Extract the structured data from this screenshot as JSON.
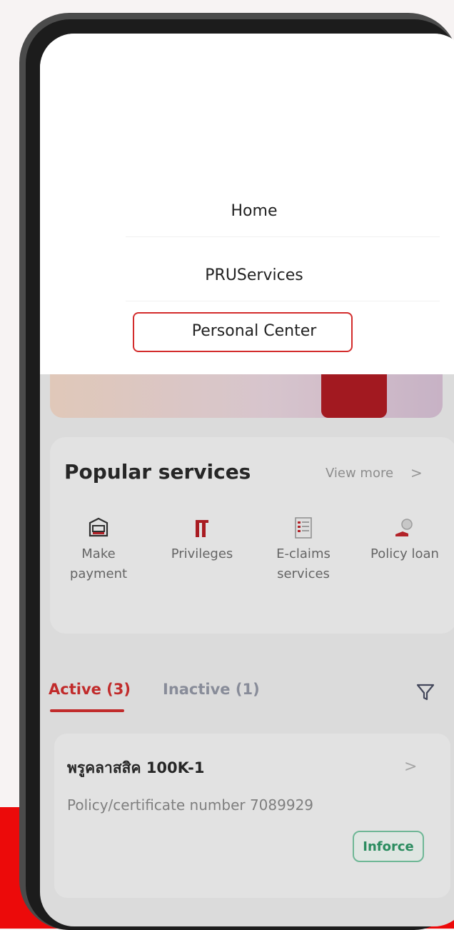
{
  "menu": {
    "items": [
      {
        "label": "Home"
      },
      {
        "label": "PRUServices"
      },
      {
        "label": "Personal Center"
      }
    ],
    "highlighted_index": 2
  },
  "popular_services": {
    "title": "Popular services",
    "view_more": "View more",
    "items": [
      {
        "label_line1": "Make",
        "label_line2": "payment",
        "icon": "card-payment-icon"
      },
      {
        "label_line1": "Privileges",
        "label_line2": "",
        "icon": "privileges-icon"
      },
      {
        "label_line1": "E-claims",
        "label_line2": "services",
        "icon": "document-claims-icon"
      },
      {
        "label_line1": "Policy loan",
        "label_line2": "",
        "icon": "policy-loan-icon"
      }
    ]
  },
  "policy_tabs": {
    "active": "Active (3)",
    "inactive": "Inactive (1)"
  },
  "policy": {
    "name": "พรูคลาสสิค 100K-1",
    "number_label": "Policy/certificate number 7089929",
    "status": "Inforce"
  },
  "colors": {
    "brand_red": "#d22f2f",
    "highlight": "#d32c2c",
    "status_green": "#2f9868"
  }
}
